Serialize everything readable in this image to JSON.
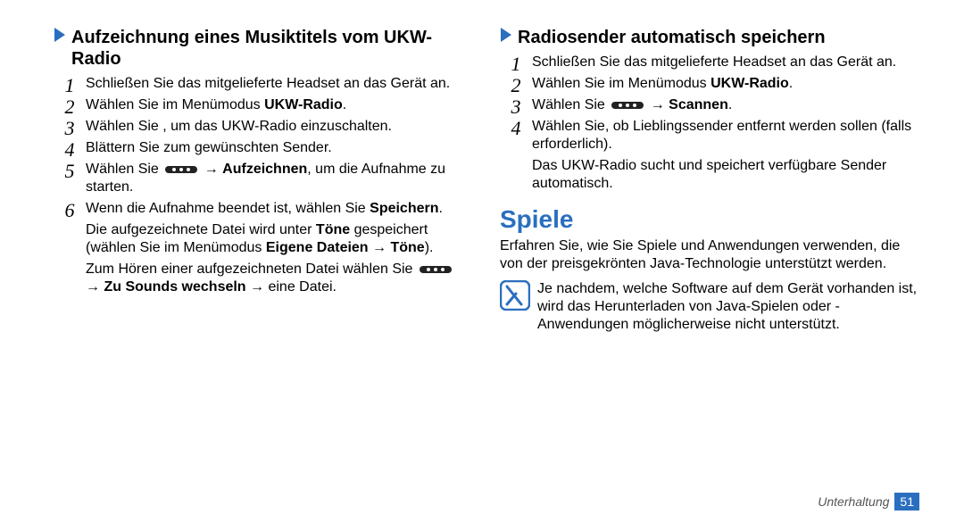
{
  "left": {
    "heading": "Aufzeichnung eines Musiktitels vom UKW-Radio",
    "steps": [
      {
        "num": "1",
        "text": "Schließen Sie das mitgelieferte Headset an das Gerät an."
      },
      {
        "num": "2",
        "pre": "Wählen Sie im Menümodus ",
        "bold": "UKW-Radio",
        "post": "."
      },
      {
        "num": "3",
        "pre": "Wählen Sie    , um das UKW-Radio einzuschalten."
      },
      {
        "num": "4",
        "text": "Blättern Sie zum gewünschten Sender."
      },
      {
        "num": "5",
        "pre": "Wählen Sie ",
        "hasDots": true,
        "arrow": " → ",
        "bold": "Aufzeichnen",
        "post": ", um die Aufnahme zu starten."
      },
      {
        "num": "6",
        "seg1_pre": "Wenn die Aufnahme beendet ist, wählen Sie ",
        "seg1_bold": "Speichern",
        "seg1_post": ".",
        "sub1_pre": "Die aufgezeichnete Datei wird unter ",
        "sub1_b1": "Töne",
        "sub1_mid": " gespeichert (wählen Sie im Menümodus ",
        "sub1_b2": "Eigene Dateien → Töne",
        "sub1_post": ").",
        "sub2_pre": "Zum Hören einer aufgezeichneten Datei wählen Sie ",
        "sub2_hasDots": true,
        "sub2_arrow_b": " → Zu Sounds wechseln",
        "sub2_post": " → eine Datei."
      }
    ]
  },
  "right": {
    "heading": "Radiosender automatisch speichern",
    "steps": [
      {
        "num": "1",
        "text": "Schließen Sie das mitgelieferte Headset an das Gerät an."
      },
      {
        "num": "2",
        "pre": "Wählen Sie im Menümodus ",
        "bold": "UKW-Radio",
        "post": "."
      },
      {
        "num": "3",
        "pre": "Wählen Sie ",
        "hasDots": true,
        "arrow": " → ",
        "bold": "Scannen",
        "post": "."
      },
      {
        "num": "4",
        "text": "Wählen Sie, ob Lieblingssender entfernt werden sollen (falls erforderlich).",
        "sub": "Das UKW-Radio sucht und speichert verfügbare Sender automatisch."
      }
    ],
    "section_title": "Spiele",
    "intro": "Erfahren Sie, wie Sie Spiele und Anwendungen verwenden, die von der preisgekrönten Java-Technologie unterstützt werden.",
    "note": "Je nachdem, welche Software auf dem Gerät vorhanden ist, wird das Herunterladen von Java-Spielen oder -Anwendungen möglicherweise nicht unterstützt."
  },
  "footer": {
    "label": "Unterhaltung",
    "page": "51"
  }
}
